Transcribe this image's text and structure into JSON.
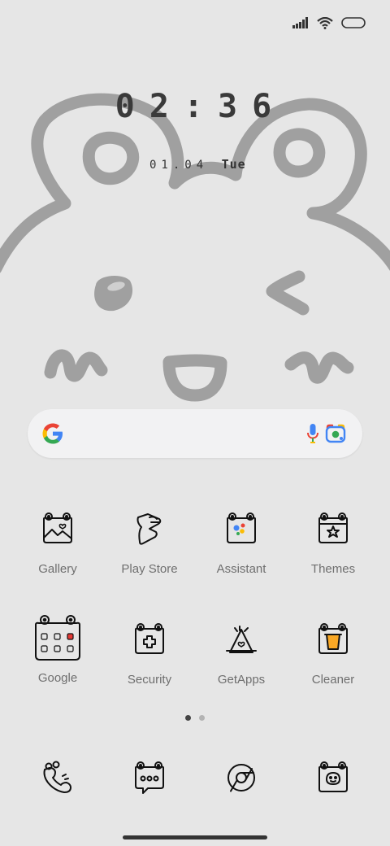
{
  "status_bar": {
    "signal_icon": "signal-bars-icon",
    "wifi_icon": "wifi-icon",
    "battery_icon": "battery-icon"
  },
  "lockclock": {
    "time": "02:36",
    "date": "01.04",
    "day": "Tue"
  },
  "search": {
    "logo_icon": "google-g-icon",
    "voice_icon": "microphone-icon",
    "lens_icon": "camera-lens-icon"
  },
  "apps": [
    {
      "label": "Gallery",
      "icon": "frog-gallery-icon"
    },
    {
      "label": "Play Store",
      "icon": "frog-play-store-icon"
    },
    {
      "label": "Assistant",
      "icon": "frog-assistant-icon"
    },
    {
      "label": "Themes",
      "icon": "frog-themes-icon"
    },
    {
      "label": "Google",
      "icon": "frog-google-folder-icon"
    },
    {
      "label": "Security",
      "icon": "frog-security-icon"
    },
    {
      "label": "GetApps",
      "icon": "frog-getapps-icon"
    },
    {
      "label": "Cleaner",
      "icon": "frog-cleaner-icon"
    }
  ],
  "pager": {
    "pages": 2,
    "active": 1
  },
  "dock": [
    {
      "icon": "frog-phone-icon"
    },
    {
      "icon": "frog-messages-icon"
    },
    {
      "icon": "chrome-icon"
    },
    {
      "icon": "frog-camera-icon"
    }
  ],
  "colors": {
    "background": "#e6e6e6",
    "wallpaper_stroke": "#a0a0a0",
    "text": "#6f6f6f"
  }
}
